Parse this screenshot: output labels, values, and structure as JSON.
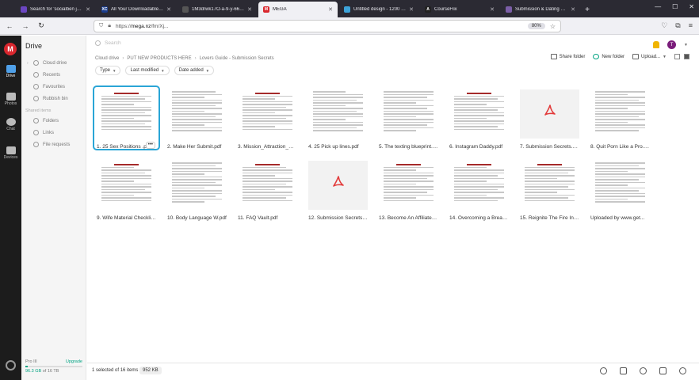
{
  "browser": {
    "tabs": [
      {
        "title": "Search for 'socialben jack dems'",
        "favicon_color": "#6b46c1",
        "favicon_text": "",
        "active": false
      },
      {
        "title": "All Your Downloadable Files",
        "favicon_color": "#1a3c8c",
        "favicon_text": "XC",
        "active": false
      },
      {
        "title": "1M3drwk17O-a-9-y-66430e8df48c...",
        "favicon_color": "#555",
        "favicon_text": "",
        "active": false
      },
      {
        "title": "MEGA",
        "favicon_color": "#d9272e",
        "favicon_text": "M",
        "active": true
      },
      {
        "title": "Untitled design - 1200 × 700px",
        "favicon_color": "#3da3d9",
        "favicon_text": "",
        "active": false
      },
      {
        "title": "CourseFlix",
        "favicon_color": "#222",
        "favicon_text": "A",
        "active": false
      },
      {
        "title": "Submission & Dating Secrets",
        "favicon_color": "#7b5ea7",
        "favicon_text": "",
        "active": false
      }
    ],
    "url_prefix": "https://",
    "url_host": "mega.nz",
    "url_path": "/fm/Xj...",
    "zoom": "80%"
  },
  "rail": {
    "logo": "M",
    "items": [
      {
        "label": "Drive",
        "active": true
      },
      {
        "label": "Photos",
        "active": false
      },
      {
        "label": "Chat",
        "active": false
      },
      {
        "label": "Devices",
        "active": false
      }
    ]
  },
  "sidebar": {
    "title": "Drive",
    "items": [
      {
        "label": "Cloud drive",
        "has_chevron": true
      },
      {
        "label": "Recents",
        "has_chevron": false
      },
      {
        "label": "Favourites",
        "has_chevron": false
      },
      {
        "label": "Rubbish bin",
        "has_chevron": false
      }
    ],
    "section": "Shared items",
    "shared": [
      {
        "label": "Folders"
      },
      {
        "label": "Links"
      },
      {
        "label": "File requests"
      }
    ],
    "storage": {
      "plan": "Pro III",
      "upgrade": "Upgrade",
      "used": "96.3 GB",
      "total": " of 16 TB",
      "fraction": 0.04
    }
  },
  "main": {
    "search_placeholder": "Search",
    "avatar_initial": "T",
    "breadcrumb": [
      "Cloud drive",
      "PUT NEW PRODUCTS HERE",
      "Lovers Guide - Submission Secrets"
    ],
    "actions": {
      "share": "Share folder",
      "new_folder": "New folder",
      "upload": "Upload..."
    },
    "filters": [
      {
        "label": "Type"
      },
      {
        "label": "Last modified"
      },
      {
        "label": "Date added"
      }
    ],
    "files": [
      {
        "name": "1. 25 Sex Positions .pdf",
        "selected": true,
        "thumb": "doc-title"
      },
      {
        "name": "2. Make Her Submit.pdf",
        "selected": false,
        "thumb": "doc"
      },
      {
        "name": "3. Mission_Attraction_Guide.pdf",
        "selected": false,
        "thumb": "doc-title"
      },
      {
        "name": "4. 25 Pick up lines.pdf",
        "selected": false,
        "thumb": "doc"
      },
      {
        "name": "5. The texting blueprint.pdf",
        "selected": false,
        "thumb": "doc"
      },
      {
        "name": "6. Instagram Daddy.pdf",
        "selected": false,
        "thumb": "doc-title"
      },
      {
        "name": "7. Submission Secrets.pdf",
        "selected": false,
        "thumb": "pdf"
      },
      {
        "name": "8. Quit Porn Like a Pro.pdf",
        "selected": false,
        "thumb": "doc"
      },
      {
        "name": "9. Wife Material Checklist.pdf",
        "selected": false,
        "thumb": "doc-title"
      },
      {
        "name": "10. Body Language W.pdf",
        "selected": false,
        "thumb": "doc"
      },
      {
        "name": "11. FAQ Vault.pdf",
        "selected": false,
        "thumb": "doc-title"
      },
      {
        "name": "12. Submission Secrets.pdf",
        "selected": false,
        "thumb": "pdf"
      },
      {
        "name": "13. Become An Affiliate.pdf",
        "selected": false,
        "thumb": "doc-title"
      },
      {
        "name": "14. Overcoming a Breakup.pdf",
        "selected": false,
        "thumb": "doc-title"
      },
      {
        "name": "15. Reignite The Fire In Your Relationship.pdf",
        "selected": false,
        "thumb": "doc-title"
      },
      {
        "name": "Uploaded by www.get...",
        "selected": false,
        "thumb": "doc"
      }
    ],
    "more_label": "•••"
  },
  "bottombar": {
    "selection": "1 selected of 16 items",
    "size": "952 KB"
  },
  "colors": {
    "accent": "#00a382",
    "mega_red": "#d9272e",
    "selected_outline": "#2aa5d6"
  }
}
